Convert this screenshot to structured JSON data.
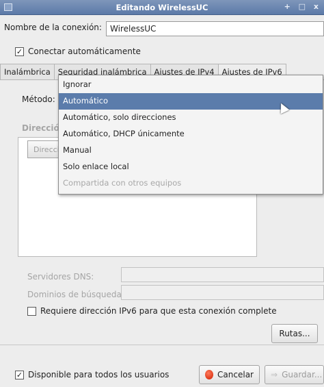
{
  "window": {
    "title": "Editando WirelessUC",
    "controls": "+ □ x"
  },
  "connection": {
    "name_label": "Nombre de la conexión:",
    "name_value": "WirelessUC",
    "auto_connect_label": "Conectar automáticamente",
    "auto_connect_checked": true
  },
  "tabs": [
    {
      "label": "Inalámbrica"
    },
    {
      "label": "Seguridad inalámbrica"
    },
    {
      "label": "Ajustes de IPv4"
    },
    {
      "label": "Ajustes de IPv6"
    }
  ],
  "ipv6": {
    "method_label": "Método:",
    "addresses_label": "Dirección",
    "address_column": "Direcci",
    "dns_label": "Servidores DNS:",
    "search_domains_label": "Dominios de búsqueda:",
    "require_label": "Requiere dirección IPv6 para que esta conexión complete",
    "routes_button": "Rutas...",
    "method_options": [
      {
        "label": "Ignorar",
        "state": "normal"
      },
      {
        "label": "Automático",
        "state": "selected"
      },
      {
        "label": "Automático, solo direcciones",
        "state": "normal"
      },
      {
        "label": "Automático, DHCP únicamente",
        "state": "normal"
      },
      {
        "label": "Manual",
        "state": "normal"
      },
      {
        "label": "Solo enlace local",
        "state": "normal"
      },
      {
        "label": "Compartida con otros equipos",
        "state": "disabled"
      }
    ]
  },
  "footer": {
    "all_users_label": "Disponible para todos los usuarios",
    "all_users_checked": true,
    "cancel_button": "Cancelar",
    "save_button": "Guardar..."
  },
  "colors": {
    "titlebar": "#6a86b1",
    "selection": "#5b7cab"
  }
}
